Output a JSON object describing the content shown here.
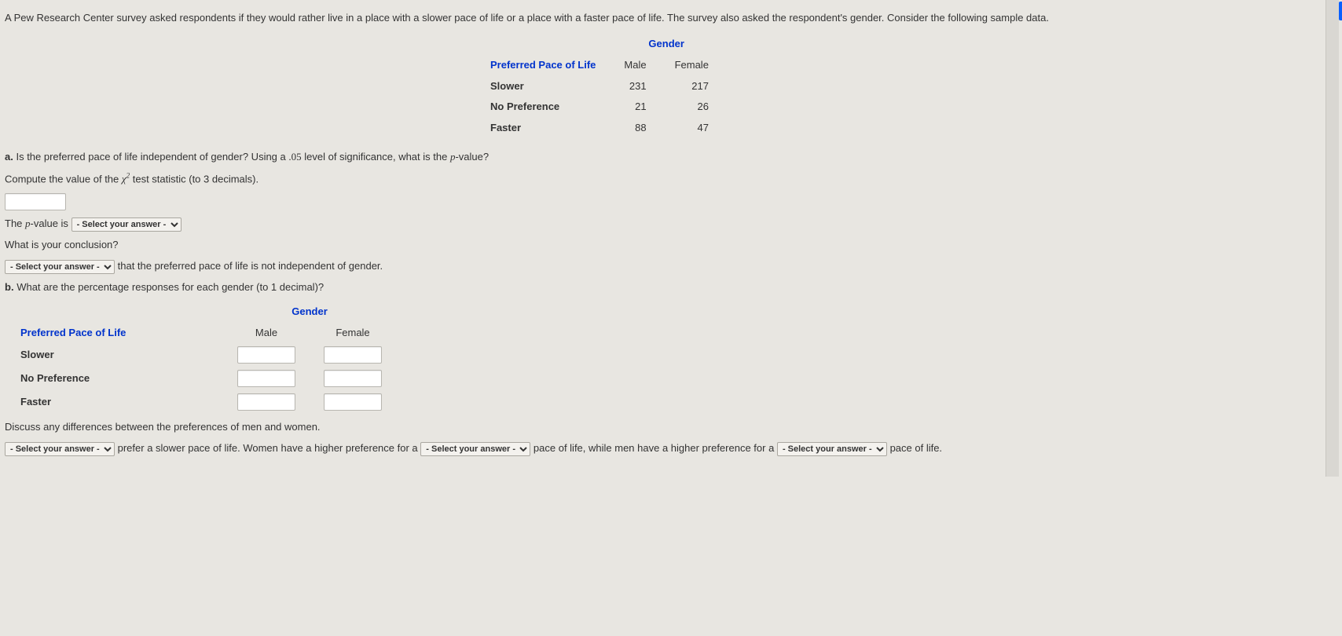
{
  "intro": "A Pew Research Center survey asked respondents if they would rather live in a place with a slower pace of life or a place with a faster pace of life. The survey also asked the respondent's gender. Consider the following sample data.",
  "t1": {
    "gender": "Gender",
    "col0": "Preferred Pace of Life",
    "col1": "Male",
    "col2": "Female",
    "rows": [
      {
        "label": "Slower",
        "male": "231",
        "female": "217"
      },
      {
        "label": "No Preference",
        "male": "21",
        "female": "26"
      },
      {
        "label": "Faster",
        "male": "88",
        "female": "47"
      }
    ]
  },
  "a": {
    "label": "a.",
    "q": "Is the preferred pace of life independent of gender? Using a ",
    "alpha": ".05",
    "q2": " level of significance, what is the ",
    "pword": "p",
    "q3": "-value?",
    "compute1": "Compute the value of the ",
    "chi": "χ",
    "sup": "2",
    "compute2": " test statistic (to 3 decimals).",
    "pline1": "The ",
    "pline2": "-value is",
    "concl": "What is your conclusion?",
    "concl_tail": "that the preferred pace of life is not independent of gender."
  },
  "b": {
    "label": "b.",
    "q": "What are the percentage responses for each gender (to 1 decimal)?",
    "gender": "Gender",
    "col0": "Preferred Pace of Life",
    "col1": "Male",
    "col2": "Female",
    "rows": [
      "Slower",
      "No Preference",
      "Faster"
    ],
    "discuss": "Discuss any differences between the preferences of men and women.",
    "s1": "prefer a slower pace of life. Women have a higher preference for a",
    "s2": "pace of life, while men have a higher preference for a",
    "s3": "pace of life."
  },
  "select_placeholder": "- Select your answer -"
}
